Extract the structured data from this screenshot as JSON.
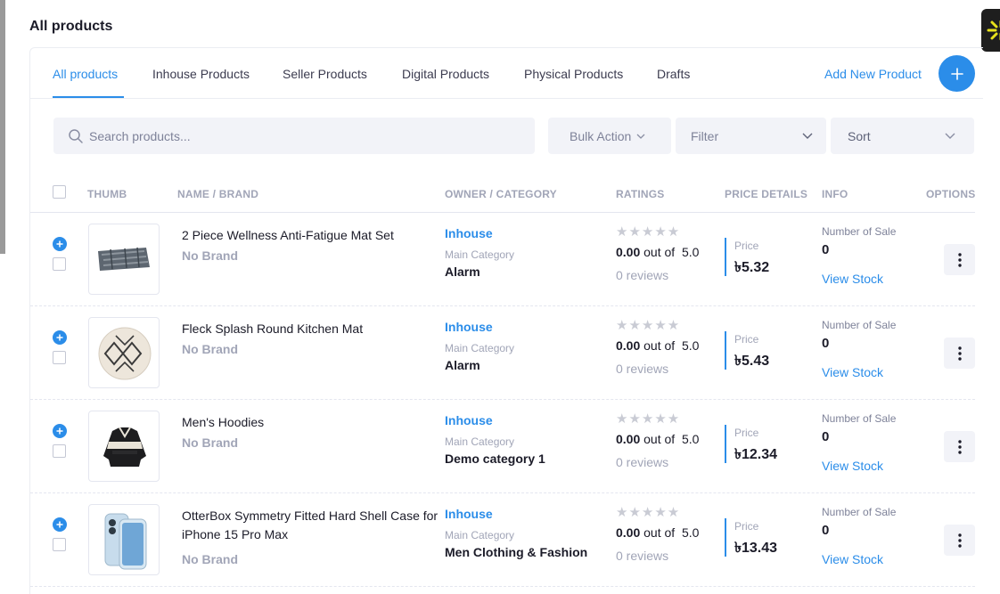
{
  "page": {
    "title": "All products"
  },
  "tabs": [
    {
      "label": "All products",
      "active": true
    },
    {
      "label": "Inhouse Products"
    },
    {
      "label": "Seller Products"
    },
    {
      "label": "Digital Products"
    },
    {
      "label": "Physical Products"
    },
    {
      "label": "Drafts"
    }
  ],
  "actions": {
    "add_new_label": "Add New Product"
  },
  "toolbar": {
    "search_placeholder": "Search products...",
    "bulk_action_label": "Bulk Action",
    "filter_label": "Filter",
    "sort_label": "Sort"
  },
  "table": {
    "columns": [
      "THUMB",
      "NAME / BRAND",
      "OWNER / CATEGORY",
      "RATINGS",
      "PRICE DETAILS",
      "INFO",
      "OPTIONS"
    ],
    "labels": {
      "main_category": "Main Category",
      "out_of": "out of",
      "rating_max": "5.0",
      "price": "Price",
      "number_of_sale": "Number of Sale",
      "view_stock": "View Stock"
    },
    "rows": [
      {
        "name": "2 Piece Wellness Anti-Fatigue Mat Set",
        "brand": "No Brand",
        "owner": "Inhouse",
        "category": "Alarm",
        "rating": "0.00",
        "reviews": "0 reviews",
        "price": "৳5.32",
        "sales": "0",
        "thumb_icon": "mat-set-image"
      },
      {
        "name": "Fleck Splash Round Kitchen Mat",
        "brand": "No Brand",
        "owner": "Inhouse",
        "category": "Alarm",
        "rating": "0.00",
        "reviews": "0 reviews",
        "price": "৳5.43",
        "sales": "0",
        "thumb_icon": "round-mat-image"
      },
      {
        "name": "Men's Hoodies",
        "brand": "No Brand",
        "owner": "Inhouse",
        "category": "Demo category 1",
        "rating": "0.00",
        "reviews": "0 reviews",
        "price": "৳12.34",
        "sales": "0",
        "thumb_icon": "hoodie-image"
      },
      {
        "name": "OtterBox Symmetry Fitted Hard Shell Case for iPhone 15 Pro Max",
        "brand": "No Brand",
        "owner": "Inhouse",
        "category": "Men Clothing & Fashion",
        "rating": "0.00",
        "reviews": "0 reviews",
        "price": "৳13.43",
        "sales": "0",
        "thumb_icon": "phone-case-image"
      }
    ]
  },
  "colors": {
    "accent": "#2b8de9",
    "muted": "#a1a5b7",
    "input_bg": "#f2f3f8",
    "badge_yellow": "#e8e21c"
  }
}
